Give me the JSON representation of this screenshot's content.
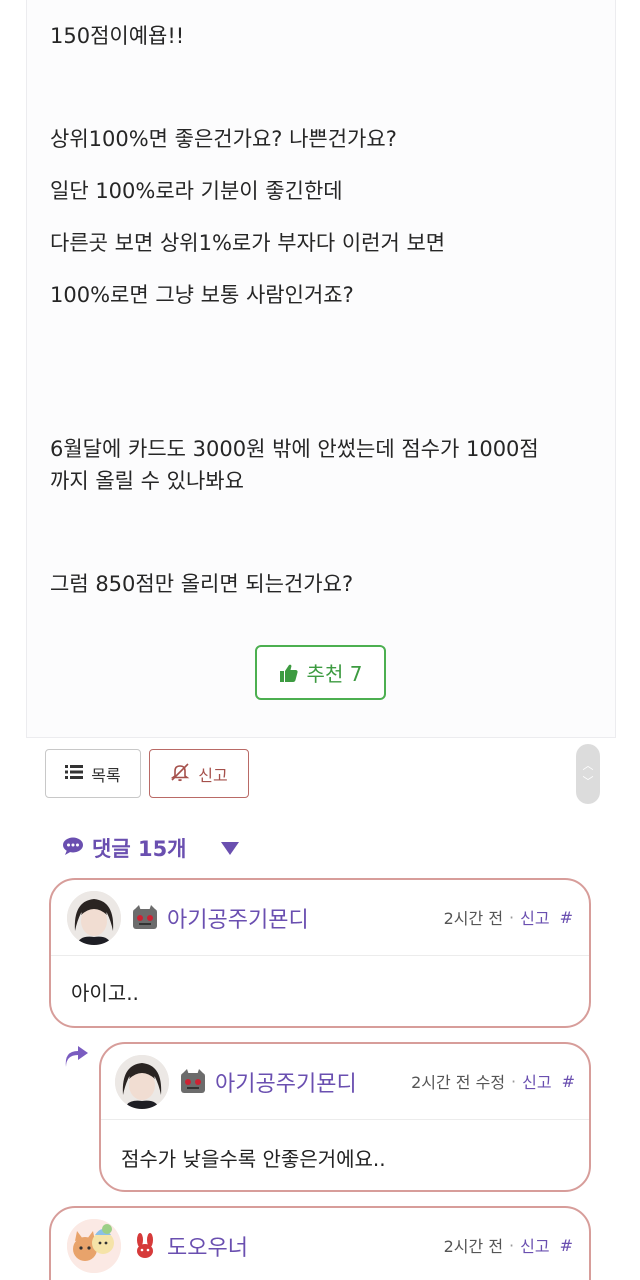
{
  "post": {
    "lines": [
      "150점이예욥!!",
      "상위100%면 좋은건가요? 나쁜건가요?",
      "일단 100%로라 기분이 좋긴한데",
      "다른곳 보면 상위1%로가 부자다 이런거 보면",
      "100%로면 그냥 보통 사람인거죠?",
      "6월달에 카드도 3000원 밖에 안썼는데 점수가 1000점",
      "까지 올릴 수 있나봐요",
      "그럼 850점만 올리면 되는건가요?"
    ],
    "recommend_label": "추천 7"
  },
  "toolbar": {
    "list_label": "목록",
    "report_label": "신고"
  },
  "comments_header": {
    "label": "댓글 15개"
  },
  "comments": [
    {
      "nickname": "아기공주기묜디",
      "time": "2시간 전",
      "report": "신고",
      "hash": "#",
      "text": "아이고.."
    },
    {
      "nickname": "아기공주기묜디",
      "time": "2시간 전 수정",
      "report": "신고",
      "hash": "#",
      "text": "점수가 낮을수록 안좋은거에요.."
    },
    {
      "nickname": "도오우너",
      "time": "2시간 전",
      "report": "신고",
      "hash": "#",
      "text": ""
    }
  ],
  "colors": {
    "accent_purple": "#6a4fb0",
    "recommend_green": "#4caf50",
    "comment_border": "#d79d9a",
    "report_red": "#a5504b"
  },
  "icons": [
    "thumbs-up-icon",
    "list-icon",
    "bell-slash-icon",
    "chat-bubble-icon",
    "caret-down-icon",
    "reply-arrow-icon",
    "scroll-up-icon",
    "scroll-down-icon"
  ]
}
